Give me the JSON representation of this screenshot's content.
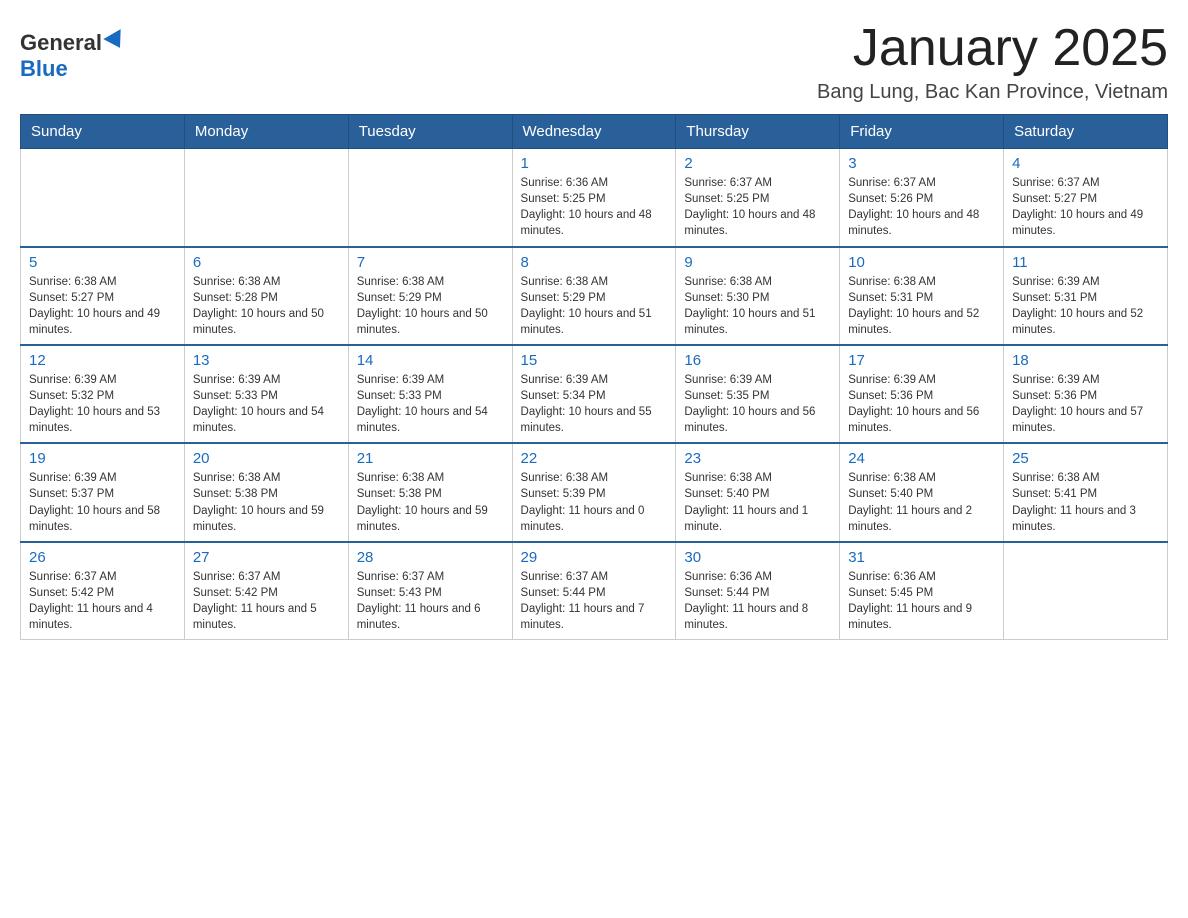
{
  "logo": {
    "general": "General",
    "blue": "Blue"
  },
  "title": "January 2025",
  "subtitle": "Bang Lung, Bac Kan Province, Vietnam",
  "days_of_week": [
    "Sunday",
    "Monday",
    "Tuesday",
    "Wednesday",
    "Thursday",
    "Friday",
    "Saturday"
  ],
  "weeks": [
    [
      {
        "day": "",
        "info": ""
      },
      {
        "day": "",
        "info": ""
      },
      {
        "day": "",
        "info": ""
      },
      {
        "day": "1",
        "info": "Sunrise: 6:36 AM\nSunset: 5:25 PM\nDaylight: 10 hours and 48 minutes."
      },
      {
        "day": "2",
        "info": "Sunrise: 6:37 AM\nSunset: 5:25 PM\nDaylight: 10 hours and 48 minutes."
      },
      {
        "day": "3",
        "info": "Sunrise: 6:37 AM\nSunset: 5:26 PM\nDaylight: 10 hours and 48 minutes."
      },
      {
        "day": "4",
        "info": "Sunrise: 6:37 AM\nSunset: 5:27 PM\nDaylight: 10 hours and 49 minutes."
      }
    ],
    [
      {
        "day": "5",
        "info": "Sunrise: 6:38 AM\nSunset: 5:27 PM\nDaylight: 10 hours and 49 minutes."
      },
      {
        "day": "6",
        "info": "Sunrise: 6:38 AM\nSunset: 5:28 PM\nDaylight: 10 hours and 50 minutes."
      },
      {
        "day": "7",
        "info": "Sunrise: 6:38 AM\nSunset: 5:29 PM\nDaylight: 10 hours and 50 minutes."
      },
      {
        "day": "8",
        "info": "Sunrise: 6:38 AM\nSunset: 5:29 PM\nDaylight: 10 hours and 51 minutes."
      },
      {
        "day": "9",
        "info": "Sunrise: 6:38 AM\nSunset: 5:30 PM\nDaylight: 10 hours and 51 minutes."
      },
      {
        "day": "10",
        "info": "Sunrise: 6:38 AM\nSunset: 5:31 PM\nDaylight: 10 hours and 52 minutes."
      },
      {
        "day": "11",
        "info": "Sunrise: 6:39 AM\nSunset: 5:31 PM\nDaylight: 10 hours and 52 minutes."
      }
    ],
    [
      {
        "day": "12",
        "info": "Sunrise: 6:39 AM\nSunset: 5:32 PM\nDaylight: 10 hours and 53 minutes."
      },
      {
        "day": "13",
        "info": "Sunrise: 6:39 AM\nSunset: 5:33 PM\nDaylight: 10 hours and 54 minutes."
      },
      {
        "day": "14",
        "info": "Sunrise: 6:39 AM\nSunset: 5:33 PM\nDaylight: 10 hours and 54 minutes."
      },
      {
        "day": "15",
        "info": "Sunrise: 6:39 AM\nSunset: 5:34 PM\nDaylight: 10 hours and 55 minutes."
      },
      {
        "day": "16",
        "info": "Sunrise: 6:39 AM\nSunset: 5:35 PM\nDaylight: 10 hours and 56 minutes."
      },
      {
        "day": "17",
        "info": "Sunrise: 6:39 AM\nSunset: 5:36 PM\nDaylight: 10 hours and 56 minutes."
      },
      {
        "day": "18",
        "info": "Sunrise: 6:39 AM\nSunset: 5:36 PM\nDaylight: 10 hours and 57 minutes."
      }
    ],
    [
      {
        "day": "19",
        "info": "Sunrise: 6:39 AM\nSunset: 5:37 PM\nDaylight: 10 hours and 58 minutes."
      },
      {
        "day": "20",
        "info": "Sunrise: 6:38 AM\nSunset: 5:38 PM\nDaylight: 10 hours and 59 minutes."
      },
      {
        "day": "21",
        "info": "Sunrise: 6:38 AM\nSunset: 5:38 PM\nDaylight: 10 hours and 59 minutes."
      },
      {
        "day": "22",
        "info": "Sunrise: 6:38 AM\nSunset: 5:39 PM\nDaylight: 11 hours and 0 minutes."
      },
      {
        "day": "23",
        "info": "Sunrise: 6:38 AM\nSunset: 5:40 PM\nDaylight: 11 hours and 1 minute."
      },
      {
        "day": "24",
        "info": "Sunrise: 6:38 AM\nSunset: 5:40 PM\nDaylight: 11 hours and 2 minutes."
      },
      {
        "day": "25",
        "info": "Sunrise: 6:38 AM\nSunset: 5:41 PM\nDaylight: 11 hours and 3 minutes."
      }
    ],
    [
      {
        "day": "26",
        "info": "Sunrise: 6:37 AM\nSunset: 5:42 PM\nDaylight: 11 hours and 4 minutes."
      },
      {
        "day": "27",
        "info": "Sunrise: 6:37 AM\nSunset: 5:42 PM\nDaylight: 11 hours and 5 minutes."
      },
      {
        "day": "28",
        "info": "Sunrise: 6:37 AM\nSunset: 5:43 PM\nDaylight: 11 hours and 6 minutes."
      },
      {
        "day": "29",
        "info": "Sunrise: 6:37 AM\nSunset: 5:44 PM\nDaylight: 11 hours and 7 minutes."
      },
      {
        "day": "30",
        "info": "Sunrise: 6:36 AM\nSunset: 5:44 PM\nDaylight: 11 hours and 8 minutes."
      },
      {
        "day": "31",
        "info": "Sunrise: 6:36 AM\nSunset: 5:45 PM\nDaylight: 11 hours and 9 minutes."
      },
      {
        "day": "",
        "info": ""
      }
    ]
  ]
}
